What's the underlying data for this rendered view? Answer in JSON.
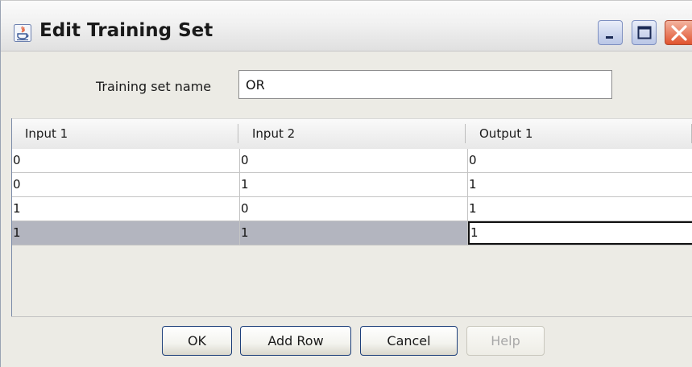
{
  "window": {
    "title": "Edit Training Set",
    "controls": [
      "minimize-icon",
      "maximize-icon",
      "close-icon"
    ]
  },
  "form": {
    "name_label": "Training set name",
    "name_value": "OR"
  },
  "table": {
    "columns": [
      "Input 1",
      "Input 2",
      "Output 1"
    ],
    "rows": [
      [
        "0",
        "0",
        "0"
      ],
      [
        "0",
        "1",
        "1"
      ],
      [
        "1",
        "0",
        "1"
      ],
      [
        "1",
        "1",
        "1"
      ]
    ],
    "selected_row": 4,
    "editing_cell": "Output 1"
  },
  "buttons": {
    "ok": "OK",
    "add_row": "Add Row",
    "cancel": "Cancel",
    "help": "Help"
  },
  "colors": {
    "selected_row": "#b3b5bf",
    "close_button": "#e0532f",
    "button_border": "#1d3f7a"
  }
}
